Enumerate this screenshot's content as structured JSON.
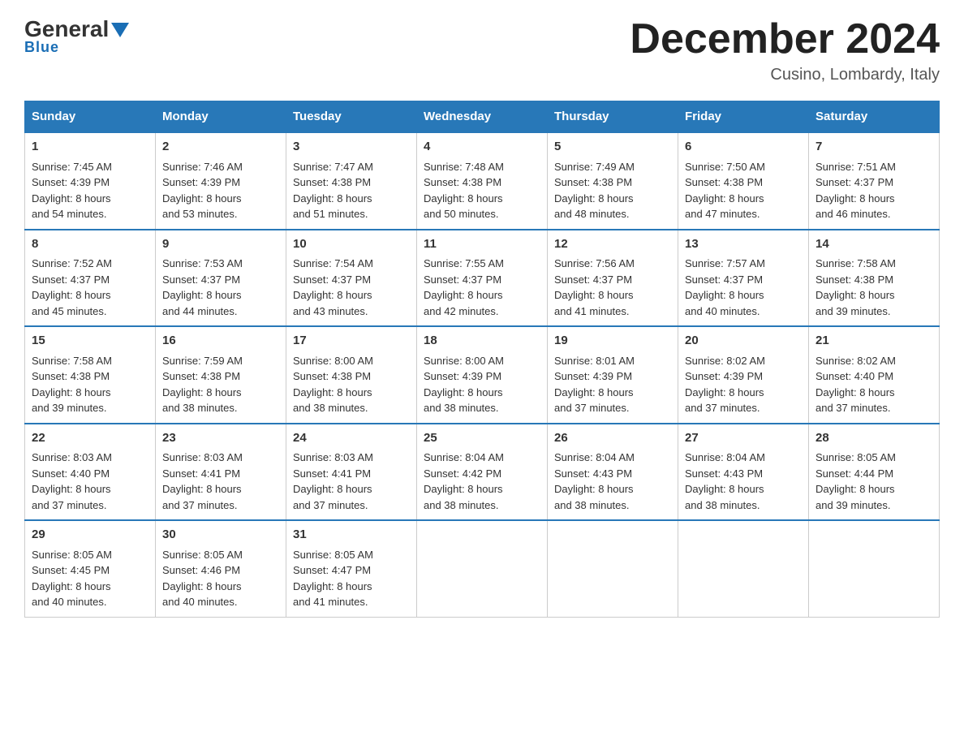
{
  "logo": {
    "general": "General",
    "blue": "Blue",
    "triangle": "▼"
  },
  "header": {
    "month_year": "December 2024",
    "location": "Cusino, Lombardy, Italy"
  },
  "days_of_week": [
    "Sunday",
    "Monday",
    "Tuesday",
    "Wednesday",
    "Thursday",
    "Friday",
    "Saturday"
  ],
  "weeks": [
    [
      {
        "day": "1",
        "sunrise": "7:45 AM",
        "sunset": "4:39 PM",
        "daylight": "8 hours and 54 minutes."
      },
      {
        "day": "2",
        "sunrise": "7:46 AM",
        "sunset": "4:39 PM",
        "daylight": "8 hours and 53 minutes."
      },
      {
        "day": "3",
        "sunrise": "7:47 AM",
        "sunset": "4:38 PM",
        "daylight": "8 hours and 51 minutes."
      },
      {
        "day": "4",
        "sunrise": "7:48 AM",
        "sunset": "4:38 PM",
        "daylight": "8 hours and 50 minutes."
      },
      {
        "day": "5",
        "sunrise": "7:49 AM",
        "sunset": "4:38 PM",
        "daylight": "8 hours and 48 minutes."
      },
      {
        "day": "6",
        "sunrise": "7:50 AM",
        "sunset": "4:38 PM",
        "daylight": "8 hours and 47 minutes."
      },
      {
        "day": "7",
        "sunrise": "7:51 AM",
        "sunset": "4:37 PM",
        "daylight": "8 hours and 46 minutes."
      }
    ],
    [
      {
        "day": "8",
        "sunrise": "7:52 AM",
        "sunset": "4:37 PM",
        "daylight": "8 hours and 45 minutes."
      },
      {
        "day": "9",
        "sunrise": "7:53 AM",
        "sunset": "4:37 PM",
        "daylight": "8 hours and 44 minutes."
      },
      {
        "day": "10",
        "sunrise": "7:54 AM",
        "sunset": "4:37 PM",
        "daylight": "8 hours and 43 minutes."
      },
      {
        "day": "11",
        "sunrise": "7:55 AM",
        "sunset": "4:37 PM",
        "daylight": "8 hours and 42 minutes."
      },
      {
        "day": "12",
        "sunrise": "7:56 AM",
        "sunset": "4:37 PM",
        "daylight": "8 hours and 41 minutes."
      },
      {
        "day": "13",
        "sunrise": "7:57 AM",
        "sunset": "4:37 PM",
        "daylight": "8 hours and 40 minutes."
      },
      {
        "day": "14",
        "sunrise": "7:58 AM",
        "sunset": "4:38 PM",
        "daylight": "8 hours and 39 minutes."
      }
    ],
    [
      {
        "day": "15",
        "sunrise": "7:58 AM",
        "sunset": "4:38 PM",
        "daylight": "8 hours and 39 minutes."
      },
      {
        "day": "16",
        "sunrise": "7:59 AM",
        "sunset": "4:38 PM",
        "daylight": "8 hours and 38 minutes."
      },
      {
        "day": "17",
        "sunrise": "8:00 AM",
        "sunset": "4:38 PM",
        "daylight": "8 hours and 38 minutes."
      },
      {
        "day": "18",
        "sunrise": "8:00 AM",
        "sunset": "4:39 PM",
        "daylight": "8 hours and 38 minutes."
      },
      {
        "day": "19",
        "sunrise": "8:01 AM",
        "sunset": "4:39 PM",
        "daylight": "8 hours and 37 minutes."
      },
      {
        "day": "20",
        "sunrise": "8:02 AM",
        "sunset": "4:39 PM",
        "daylight": "8 hours and 37 minutes."
      },
      {
        "day": "21",
        "sunrise": "8:02 AM",
        "sunset": "4:40 PM",
        "daylight": "8 hours and 37 minutes."
      }
    ],
    [
      {
        "day": "22",
        "sunrise": "8:03 AM",
        "sunset": "4:40 PM",
        "daylight": "8 hours and 37 minutes."
      },
      {
        "day": "23",
        "sunrise": "8:03 AM",
        "sunset": "4:41 PM",
        "daylight": "8 hours and 37 minutes."
      },
      {
        "day": "24",
        "sunrise": "8:03 AM",
        "sunset": "4:41 PM",
        "daylight": "8 hours and 37 minutes."
      },
      {
        "day": "25",
        "sunrise": "8:04 AM",
        "sunset": "4:42 PM",
        "daylight": "8 hours and 38 minutes."
      },
      {
        "day": "26",
        "sunrise": "8:04 AM",
        "sunset": "4:43 PM",
        "daylight": "8 hours and 38 minutes."
      },
      {
        "day": "27",
        "sunrise": "8:04 AM",
        "sunset": "4:43 PM",
        "daylight": "8 hours and 38 minutes."
      },
      {
        "day": "28",
        "sunrise": "8:05 AM",
        "sunset": "4:44 PM",
        "daylight": "8 hours and 39 minutes."
      }
    ],
    [
      {
        "day": "29",
        "sunrise": "8:05 AM",
        "sunset": "4:45 PM",
        "daylight": "8 hours and 40 minutes."
      },
      {
        "day": "30",
        "sunrise": "8:05 AM",
        "sunset": "4:46 PM",
        "daylight": "8 hours and 40 minutes."
      },
      {
        "day": "31",
        "sunrise": "8:05 AM",
        "sunset": "4:47 PM",
        "daylight": "8 hours and 41 minutes."
      },
      null,
      null,
      null,
      null
    ]
  ],
  "labels": {
    "sunrise": "Sunrise:",
    "sunset": "Sunset:",
    "daylight": "Daylight:"
  }
}
